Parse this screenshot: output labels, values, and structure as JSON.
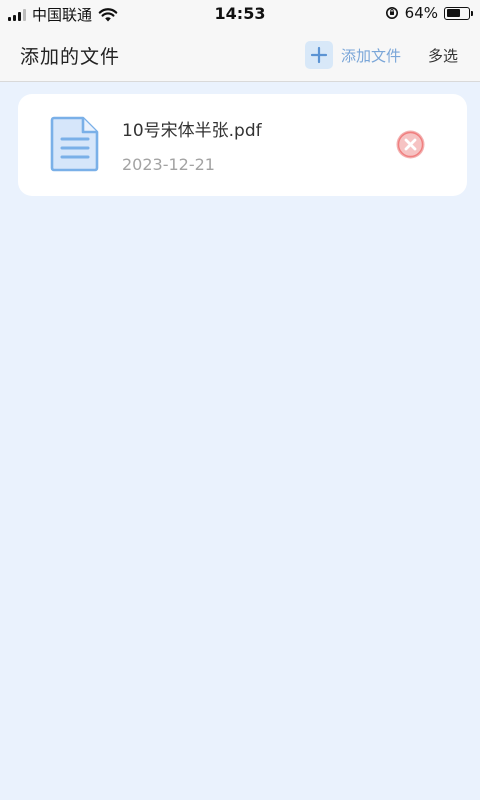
{
  "status_bar": {
    "carrier": "中国联通",
    "time": "14:53",
    "battery_percent": "64%",
    "battery_level": 0.64,
    "icons": [
      "signal-icon",
      "wifi-icon",
      "orientation-lock-icon",
      "battery-icon"
    ]
  },
  "header": {
    "title": "添加的文件",
    "add_file_label": "添加文件",
    "multi_select_label": "多选",
    "accent_color": "#7aa6d8"
  },
  "files": [
    {
      "name": "10号宋体半张.pdf",
      "date": "2023-12-21",
      "icon": "document-icon",
      "remove_icon": "remove-icon"
    }
  ],
  "colors": {
    "background": "#eaf2fd",
    "card": "#ffffff",
    "remove": "#f07f7f",
    "doc_icon": "#7ab0e8"
  }
}
